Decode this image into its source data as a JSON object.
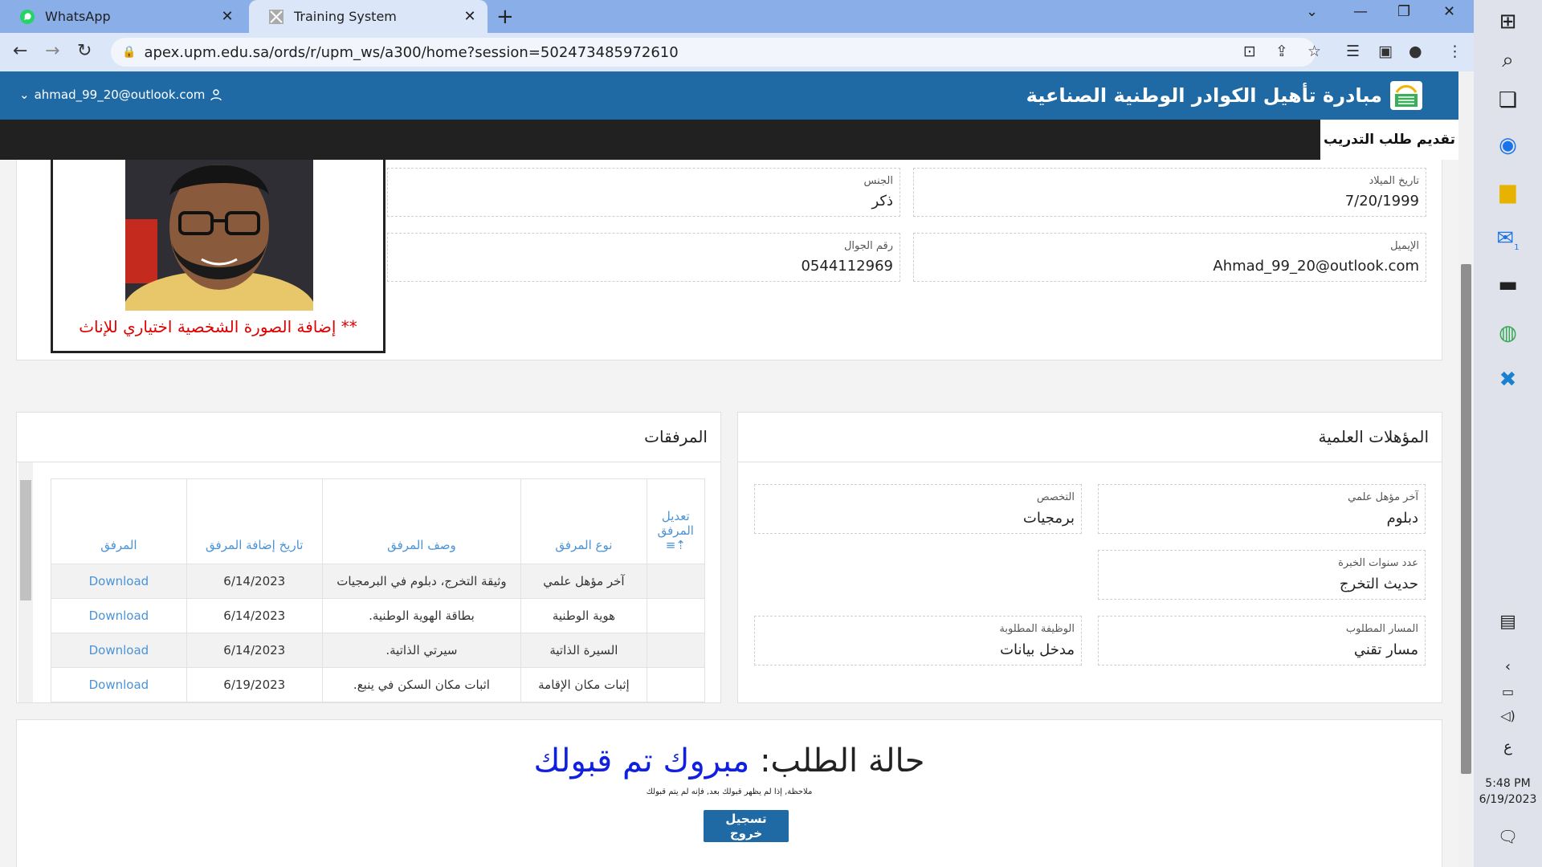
{
  "browser": {
    "tabs": [
      {
        "label": "WhatsApp",
        "active": false
      },
      {
        "label": "Training System",
        "active": true
      }
    ],
    "url": "apex.upm.edu.sa/ords/r/upm_ws/a300/home?session=502473485972610"
  },
  "app": {
    "brand": "مبادرة تأهيل الكوادر الوطنية الصناعية",
    "user_email": "ahmad_99_20@outlook.com",
    "menu_item": "تقديم طلب التدريب"
  },
  "profile": {
    "photo_note": "** إضافة الصورة الشخصية اختياري للإناث",
    "fields": {
      "birth_date": {
        "label": "تاريخ الميلاد",
        "value": "7/20/1999"
      },
      "gender": {
        "label": "الجنس",
        "value": "ذكر"
      },
      "email": {
        "label": "الإيميل",
        "value": "Ahmad_99_20@outlook.com"
      },
      "mobile": {
        "label": "رقم الجوال",
        "value": "0544112969"
      }
    }
  },
  "qualifications": {
    "title": "المؤهلات العلمية",
    "fields": {
      "last_qualification": {
        "label": "آخر مؤهل علمي",
        "value": "دبلوم"
      },
      "major": {
        "label": "التخصص",
        "value": "برمجيات"
      },
      "experience_years": {
        "label": "عدد سنوات الخبرة",
        "value": "حديث التخرج"
      },
      "track": {
        "label": "المسار المطلوب",
        "value": "مسار تقني"
      },
      "job": {
        "label": "الوظيفة المطلوبة",
        "value": "مدخل بيانات"
      }
    }
  },
  "attachments": {
    "title": "المرفقات",
    "columns": [
      "تعديل المرفق",
      "نوع المرفق",
      "وصف المرفق",
      "تاريخ إضافة المرفق",
      "المرفق"
    ],
    "rows": [
      {
        "type": "آخر مؤهل علمي",
        "desc": "وثيقة التخرج، دبلوم في البرمجيات",
        "date": "6/14/2023",
        "file": "Download"
      },
      {
        "type": "هوية الوطنية",
        "desc": "بطاقة الهوية الوطنية.",
        "date": "6/14/2023",
        "file": "Download"
      },
      {
        "type": "السيرة الذاتية",
        "desc": "سيرتي الذاتية.",
        "date": "6/14/2023",
        "file": "Download"
      },
      {
        "type": "إثبات مكان الإقامة",
        "desc": "اثبات مكان السكن في ينبع.",
        "date": "6/19/2023",
        "file": "Download"
      }
    ]
  },
  "status": {
    "label": "حالة الطلب:",
    "value": "مبروك تم قبولك",
    "note": "ملاحظة, إذا لم يظهر قبولك بعد, فإنه لم يتم قبولك",
    "logout": "تسجيل خروج"
  },
  "taskbar": {
    "time": "5:48 PM",
    "date": "6/19/2023",
    "lang": "ع",
    "mail_badge": "1"
  }
}
